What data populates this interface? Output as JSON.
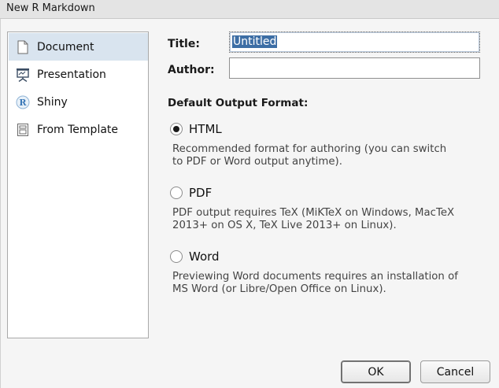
{
  "window": {
    "title": "New R Markdown"
  },
  "sidebar": {
    "items": [
      {
        "label": "Document",
        "icon": "document-icon",
        "selected": true
      },
      {
        "label": "Presentation",
        "icon": "presentation-icon",
        "selected": false
      },
      {
        "label": "Shiny",
        "icon": "shiny-icon",
        "selected": false
      },
      {
        "label": "From Template",
        "icon": "template-icon",
        "selected": false
      }
    ]
  },
  "form": {
    "title_label": "Title:",
    "title_value": "Untitled",
    "author_label": "Author:",
    "author_value": "",
    "section_title": "Default Output Format:",
    "formats": [
      {
        "label": "HTML",
        "selected": true,
        "description_line1": "Recommended format for authoring (you can switch",
        "description_line2": "to PDF or Word output anytime)."
      },
      {
        "label": "PDF",
        "selected": false,
        "description_line1": "PDF output requires TeX (MiKTeX on Windows, MacTeX",
        "description_line2": "2013+ on OS X, TeX Live 2013+ on Linux)."
      },
      {
        "label": "Word",
        "selected": false,
        "description_line1": "Previewing Word documents requires an installation of",
        "description_line2": "MS Word (or Libre/Open Office on Linux)."
      }
    ]
  },
  "buttons": {
    "ok": "OK",
    "cancel": "Cancel"
  },
  "colors": {
    "selection_bg": "#d9e4ef",
    "text_selection": "#3d6ea5",
    "shiny_blue": "#3a78b8"
  }
}
